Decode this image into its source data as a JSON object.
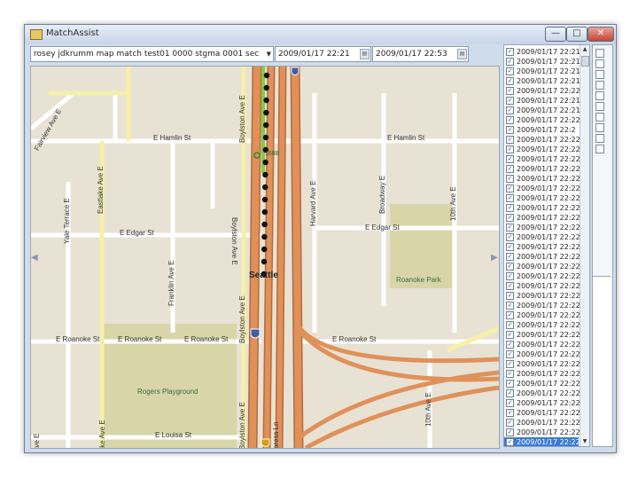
{
  "window": {
    "title": "MatchAssist",
    "minimize_label": "—",
    "maximize_label": "□",
    "close_label": "✕"
  },
  "toolbar": {
    "combo_value": "rosey jdkrumm map match test01 0000 stgma 0001 sec",
    "start_time": "2009/01/17 22:21",
    "end_time": "2009/01/17 22:53"
  },
  "map": {
    "streets": {
      "hamlin_left": "E Hamlin St",
      "hamlin_right": "E Hamlin St",
      "edgar_left": "E Edgar St",
      "edgar_right": "E Edgar St",
      "roanoke_1": "E Roanoke St",
      "roanoke_2": "E Roanoke St",
      "roanoke_3": "E Roanoke St",
      "roanoke_4": "E Roanoke St",
      "louisa": "E Louisa St",
      "fairview": "Fairview Ave E",
      "yale": "Yale Terrace E",
      "eastlake_top": "Eastlake Ave E",
      "franklin": "Franklin Ave E",
      "boylston_top": "Boylston Ave E",
      "boylston_mid_top": "Boylston Ave E",
      "boylston_mid": "Boylston Ave E",
      "boylston_bottom": "Boylston Ave E",
      "harvard": "Harvard Ave E",
      "broadway": "Broadway E",
      "tenth_top": "10th Ave E",
      "tenth_bottom": "10th Ave E",
      "yale_bottom": "Yale Ave E",
      "eastlake_bottom": "Eastlake Ave E",
      "express": "I-5 Express Ln"
    },
    "parks": {
      "roanoke": "Roanoke Park",
      "rogers": "Rogers Playground"
    },
    "city": "Seattle",
    "exit_label": "168B",
    "shield_label": "5",
    "track_point_count": 17
  },
  "list": {
    "rows": [
      {
        "text": "2009/01/17 22:21:",
        "checked": true
      },
      {
        "text": "2009/01/17 22:21:",
        "checked": true
      },
      {
        "text": "2009/01/17 22:21:",
        "checked": true
      },
      {
        "text": "2009/01/17 22:21:",
        "checked": true
      },
      {
        "text": "2009/01/17 22:22:",
        "checked": true
      },
      {
        "text": "2009/01/17 22:21:",
        "checked": true
      },
      {
        "text": "2009/01/17 22:21:",
        "checked": true
      },
      {
        "text": "2009/01/17 22:22:",
        "checked": true
      },
      {
        "text": "2009/01/17 22:2",
        "checked": true
      },
      {
        "text": "2009/01/17 22:22.",
        "checked": true
      },
      {
        "text": "2009/01/17 22:22.",
        "checked": true
      },
      {
        "text": "2009/01/17 22:22.",
        "checked": true
      },
      {
        "text": "2009/01/17 22:22.",
        "checked": true
      },
      {
        "text": "2009/01/17 22:22.",
        "checked": true
      },
      {
        "text": "2009/01/17 22:22.",
        "checked": true
      },
      {
        "text": "2009/01/17 22:22.",
        "checked": true
      },
      {
        "text": "2009/01/17 22:22.",
        "checked": true
      },
      {
        "text": "2009/01/17 22:22.",
        "checked": true
      },
      {
        "text": "2009/01/17 22:22.",
        "checked": true
      },
      {
        "text": "2009/01/17 22:22.",
        "checked": true
      },
      {
        "text": "2009/01/17 22:22.",
        "checked": true
      },
      {
        "text": "2009/01/17 22:22.",
        "checked": true
      },
      {
        "text": "2009/01/17 22:22.",
        "checked": true
      },
      {
        "text": "2009/01/17 22:22.",
        "checked": true
      },
      {
        "text": "2009/01/17 22:22.",
        "checked": true
      },
      {
        "text": "2009/01/17 22:22.",
        "checked": true
      },
      {
        "text": "2009/01/17 22:22.",
        "checked": true
      },
      {
        "text": "2009/01/17 22:22.",
        "checked": true
      },
      {
        "text": "2009/01/17 22:22.",
        "checked": true
      },
      {
        "text": "2009/01/17 22:22.",
        "checked": true
      },
      {
        "text": "2009/01/17 22:22.",
        "checked": true
      },
      {
        "text": "2009/01/17 22:22.",
        "checked": true
      },
      {
        "text": "2009/01/17 22:22.",
        "checked": true
      },
      {
        "text": "2009/01/17 22:22.",
        "checked": true
      },
      {
        "text": "2009/01/17 22:22.",
        "checked": true
      },
      {
        "text": "2009/01/17 22:22.",
        "checked": true
      },
      {
        "text": "2009/01/17 22:22.",
        "checked": true
      },
      {
        "text": "2009/01/17 22:22.",
        "checked": true
      },
      {
        "text": "2009/01/17 22:22.",
        "checked": true
      },
      {
        "text": "2009/01/17 22:22.",
        "checked": true
      },
      {
        "text": "2009/01/17 22:22.",
        "checked": true
      }
    ],
    "selected_index": 40,
    "scroll_down": "▼",
    "scroll_up": "▲"
  },
  "colors": {
    "freeway": "#e0915a",
    "freeway_edge": "#b66a3a",
    "arterial": "#f6f0a8",
    "track_point": "#111111",
    "track_highlight": "#7fce4a",
    "park": "#d8d5a8"
  }
}
